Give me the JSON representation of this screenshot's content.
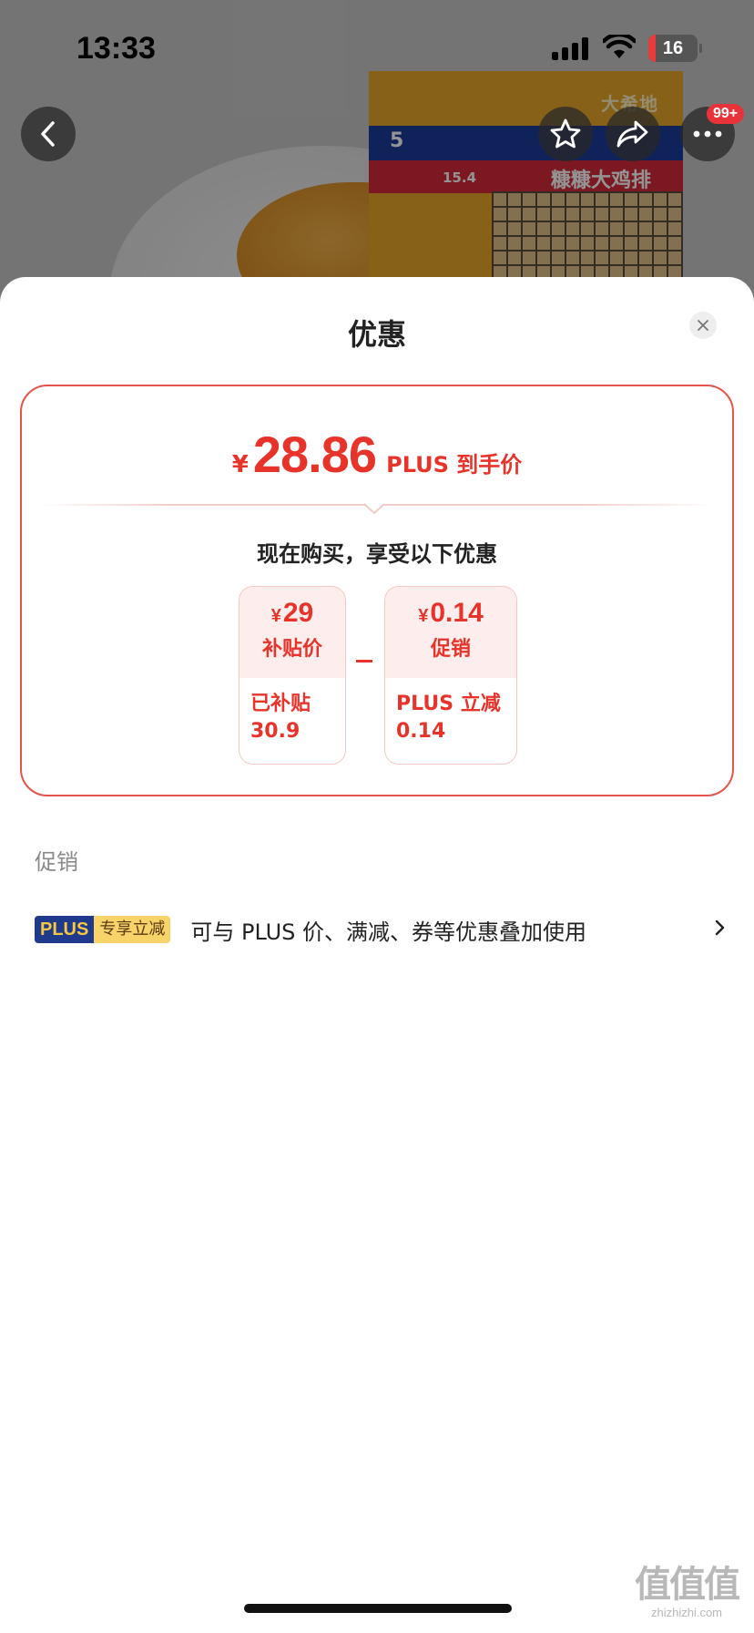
{
  "status_bar": {
    "time": "13:33",
    "battery": "16"
  },
  "product_image": {
    "brand": "大希地",
    "name": "糠糠大鸡排",
    "minutes": "5",
    "weight": "15.4"
  },
  "nav": {
    "back_icon": "chevron-left-icon",
    "favorite_icon": "star-icon",
    "share_icon": "share-icon",
    "more_icon": "ellipsis-icon",
    "more_badge": "99+"
  },
  "sheet": {
    "title": "优惠",
    "close_icon": "close-icon"
  },
  "price_card": {
    "currency": "¥",
    "price": "28.86",
    "price_tag": "PLUS 到手价",
    "subtitle": "现在购买，享受以下优惠",
    "items": [
      {
        "currency": "¥",
        "amount": "29",
        "label": "补贴价",
        "detail_line1": "已补贴",
        "detail_line2": "30.9"
      },
      {
        "currency": "¥",
        "amount": "0.14",
        "label": "促销",
        "detail_line1": "PLUS 立减",
        "detail_line2": "0.14"
      }
    ],
    "operator": "−"
  },
  "promotions": {
    "section_label": "促销",
    "row": {
      "badge_plus": "PLUS",
      "badge_exclusive": "专享立减",
      "description": "可与 PLUS 价、满减、券等优惠叠加使用",
      "arrow_icon": "chevron-right-icon"
    }
  },
  "watermark": {
    "main": "值值值",
    "url": "zhizhizhi.com"
  },
  "colors": {
    "accent_red": "#e8332a",
    "plus_blue": "#1f3a8a",
    "plus_gold": "#f7d36a"
  }
}
